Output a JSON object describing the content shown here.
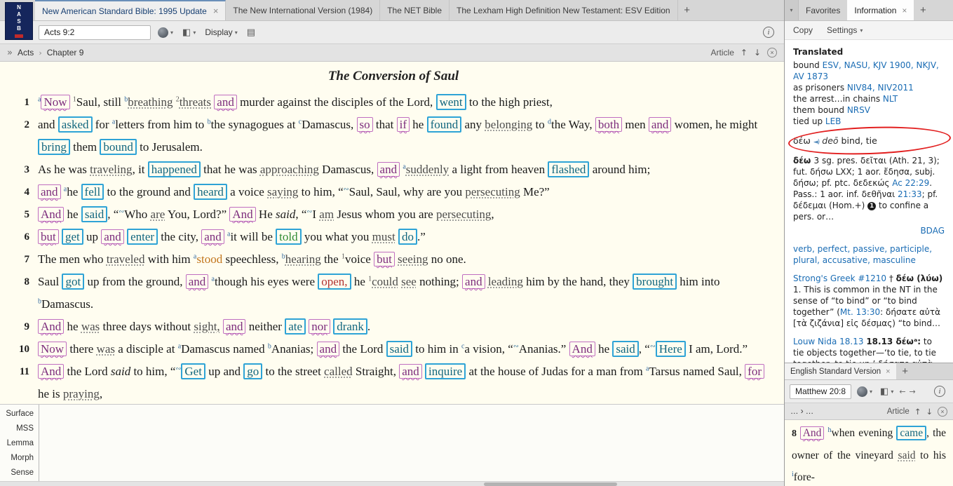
{
  "colors": {
    "accent_blue_box": "#2ea3d6",
    "accent_purple_box": "#c06ec0",
    "link_blue": "#1a6cb4",
    "annotation_red": "#e21f1f",
    "page_cream": "#fffdf0"
  },
  "icons": {
    "caret_down": "▾",
    "chevrons": "»",
    "up_arrow": "↑",
    "down_arrow": "↓",
    "back_arrow": "←",
    "forward_arrow": "→",
    "close": "×",
    "columns": "◧",
    "page": "▤",
    "info": "i",
    "crumb_sep": "›"
  },
  "main": {
    "logo": "NASB",
    "tabs": [
      {
        "label": "New American Standard Bible: 1995 Update",
        "close": "×"
      },
      {
        "label": "The New International Version (1984)"
      },
      {
        "label": "The NET Bible"
      },
      {
        "label": "The Lexham High Definition New Testament: ESV Edition"
      }
    ],
    "new_tab": "+",
    "toolbar": {
      "reference": "Acts 9:2",
      "display_label": "Display"
    },
    "locator": {
      "book": "Acts",
      "chapter": "Chapter 9",
      "article_label": "Article"
    },
    "title": "The Conversion of Saul",
    "interlinear_rows": [
      "Surface",
      "MSS",
      "Lemma",
      "Morph",
      "Sense"
    ],
    "verses": [
      {
        "num": "1",
        "tokens": [
          [
            "a",
            "sup"
          ],
          [
            "Now",
            "p"
          ],
          [
            " ",
            "t"
          ],
          [
            "1",
            "supg"
          ],
          [
            "Saul, still ",
            "t"
          ],
          [
            "b",
            "sup"
          ],
          [
            "breathing",
            "d"
          ],
          [
            " ",
            "t"
          ],
          [
            "2",
            "supg"
          ],
          [
            "threats",
            "d"
          ],
          [
            " ",
            "t"
          ],
          [
            "and",
            "p"
          ],
          [
            " murder against the disciples of the Lord, ",
            "t"
          ],
          [
            "went",
            "b"
          ],
          [
            " to the high priest,",
            "t"
          ]
        ]
      },
      {
        "num": "2",
        "tokens": [
          [
            "and ",
            "t"
          ],
          [
            "asked",
            "b"
          ],
          [
            " for ",
            "t"
          ],
          [
            "a",
            "sup"
          ],
          [
            "letters from him to ",
            "t"
          ],
          [
            "b",
            "sup"
          ],
          [
            "the synagogues at ",
            "t"
          ],
          [
            "c",
            "sup"
          ],
          [
            "Damascus, ",
            "t"
          ],
          [
            "so",
            "p"
          ],
          [
            " that ",
            "t"
          ],
          [
            "if",
            "p"
          ],
          [
            " he ",
            "t"
          ],
          [
            "found",
            "b"
          ],
          [
            " any ",
            "t"
          ],
          [
            "belonging",
            "d"
          ],
          [
            " to ",
            "t"
          ],
          [
            "d",
            "sup"
          ],
          [
            "the Way, ",
            "t"
          ],
          [
            "both",
            "p"
          ],
          [
            " men ",
            "t"
          ],
          [
            "and",
            "p"
          ],
          [
            " women, he might ",
            "t"
          ],
          [
            "bring",
            "b"
          ],
          [
            " them ",
            "t"
          ],
          [
            "bound",
            "b"
          ],
          [
            " to Jerusalem.",
            "t"
          ]
        ]
      },
      {
        "num": "3",
        "tokens": [
          [
            "As he was ",
            "t"
          ],
          [
            "traveling",
            "d"
          ],
          [
            ", it ",
            "t"
          ],
          [
            "happened",
            "b"
          ],
          [
            " that he was ",
            "t"
          ],
          [
            "approaching",
            "d"
          ],
          [
            " Damascus, ",
            "t"
          ],
          [
            "and",
            "p"
          ],
          [
            " ",
            "t"
          ],
          [
            "a",
            "sup"
          ],
          [
            "suddenly",
            "d"
          ],
          [
            " a light from heaven ",
            "t"
          ],
          [
            "flashed",
            "b"
          ],
          [
            " around him;",
            "t"
          ]
        ]
      },
      {
        "num": "4",
        "tokens": [
          [
            "and",
            "p"
          ],
          [
            " ",
            "t"
          ],
          [
            "a",
            "sup"
          ],
          [
            "he ",
            "t"
          ],
          [
            "fell",
            "b"
          ],
          [
            " to the ground and ",
            "t"
          ],
          [
            "heard",
            "b"
          ],
          [
            " a voice ",
            "t"
          ],
          [
            "saying",
            "d"
          ],
          [
            " to him, “",
            "t"
          ],
          [
            "∾",
            "m"
          ],
          [
            "Saul, Saul, why are you ",
            "t"
          ],
          [
            "persecuting",
            "d"
          ],
          [
            " Me?”",
            "t"
          ]
        ]
      },
      {
        "num": "5",
        "tokens": [
          [
            "And",
            "p"
          ],
          [
            " he ",
            "t"
          ],
          [
            "said",
            "b"
          ],
          [
            ", “",
            "t"
          ],
          [
            "∾",
            "m"
          ],
          [
            "Who ",
            "t"
          ],
          [
            "are",
            "d"
          ],
          [
            " You, Lord?” ",
            "t"
          ],
          [
            "And",
            "p"
          ],
          [
            " He ",
            "t"
          ],
          [
            "said",
            "i"
          ],
          [
            ", “",
            "t"
          ],
          [
            "∾",
            "m"
          ],
          [
            "I ",
            "t"
          ],
          [
            "am",
            "d"
          ],
          [
            " Jesus whom you are ",
            "t"
          ],
          [
            "persecuting",
            "d"
          ],
          [
            ",",
            "t"
          ]
        ]
      },
      {
        "num": "6",
        "tokens": [
          [
            "but",
            "p"
          ],
          [
            " ",
            "t"
          ],
          [
            "get",
            "b"
          ],
          [
            " up ",
            "t"
          ],
          [
            "and",
            "p"
          ],
          [
            " ",
            "t"
          ],
          [
            "enter",
            "b"
          ],
          [
            " the city, ",
            "t"
          ],
          [
            "and",
            "p"
          ],
          [
            " ",
            "t"
          ],
          [
            "a",
            "sup"
          ],
          [
            "it will be ",
            "t"
          ],
          [
            "told",
            "bg"
          ],
          [
            " you what you ",
            "t"
          ],
          [
            "must",
            "d"
          ],
          [
            " ",
            "t"
          ],
          [
            "do",
            "b"
          ],
          [
            ".”",
            "t"
          ]
        ]
      },
      {
        "num": "7",
        "tokens": [
          [
            "The men who ",
            "t"
          ],
          [
            "traveled",
            "d"
          ],
          [
            " with him ",
            "t"
          ],
          [
            "a",
            "sup"
          ],
          [
            "stood",
            "o"
          ],
          [
            " speechless, ",
            "t"
          ],
          [
            "b",
            "sup"
          ],
          [
            "hearing",
            "d"
          ],
          [
            " the ",
            "t"
          ],
          [
            "1",
            "supg"
          ],
          [
            "voice ",
            "t"
          ],
          [
            "but",
            "p"
          ],
          [
            " ",
            "t"
          ],
          [
            "seeing",
            "d"
          ],
          [
            " no one.",
            "t"
          ]
        ]
      },
      {
        "num": "8",
        "tokens": [
          [
            "Saul ",
            "t"
          ],
          [
            "got",
            "b"
          ],
          [
            " up from the ground, ",
            "t"
          ],
          [
            "and",
            "p"
          ],
          [
            " ",
            "t"
          ],
          [
            "a",
            "sup"
          ],
          [
            "though his eyes were ",
            "t"
          ],
          [
            "open,",
            "br"
          ],
          [
            " he ",
            "t"
          ],
          [
            "1",
            "supg"
          ],
          [
            "could",
            "d"
          ],
          [
            " ",
            "t"
          ],
          [
            "see",
            "d"
          ],
          [
            " nothing; ",
            "t"
          ],
          [
            "and",
            "p"
          ],
          [
            " ",
            "t"
          ],
          [
            "leading",
            "d"
          ],
          [
            " him by the hand, they ",
            "t"
          ],
          [
            "brought",
            "b"
          ],
          [
            " him into ",
            "t"
          ],
          [
            "b",
            "sup"
          ],
          [
            "Damascus.",
            "t"
          ]
        ]
      },
      {
        "num": "9",
        "tokens": [
          [
            "And",
            "p"
          ],
          [
            " he ",
            "t"
          ],
          [
            "was",
            "d"
          ],
          [
            " three days without ",
            "t"
          ],
          [
            "sight,",
            "d"
          ],
          [
            " ",
            "t"
          ],
          [
            "and",
            "p"
          ],
          [
            " neither ",
            "t"
          ],
          [
            "ate",
            "b"
          ],
          [
            " ",
            "t"
          ],
          [
            "nor",
            "p"
          ],
          [
            " ",
            "t"
          ],
          [
            "drank",
            "b"
          ],
          [
            ".",
            "t"
          ]
        ]
      },
      {
        "num": "10",
        "tokens": [
          [
            "Now",
            "p"
          ],
          [
            " there ",
            "t"
          ],
          [
            "was",
            "d"
          ],
          [
            " a disciple at ",
            "t"
          ],
          [
            "a",
            "sup"
          ],
          [
            "Damascus named ",
            "t"
          ],
          [
            "b",
            "sup"
          ],
          [
            "Ananias; ",
            "t"
          ],
          [
            "and",
            "p"
          ],
          [
            " the Lord ",
            "t"
          ],
          [
            "said",
            "b"
          ],
          [
            " to him in ",
            "t"
          ],
          [
            "c",
            "sup"
          ],
          [
            "a vision, “",
            "t"
          ],
          [
            "∾",
            "m"
          ],
          [
            "Ananias.” ",
            "t"
          ],
          [
            "And",
            "p"
          ],
          [
            " he ",
            "t"
          ],
          [
            "said",
            "b"
          ],
          [
            ", “",
            "t"
          ],
          [
            "∾",
            "m"
          ],
          [
            "Here",
            "b"
          ],
          [
            " I am, Lord.”",
            "t"
          ]
        ]
      },
      {
        "num": "11",
        "tokens": [
          [
            "And",
            "p"
          ],
          [
            " the Lord ",
            "t"
          ],
          [
            "said",
            "i"
          ],
          [
            " to him, “",
            "t"
          ],
          [
            "∾",
            "m"
          ],
          [
            "Get",
            "b"
          ],
          [
            " up and ",
            "t"
          ],
          [
            "go",
            "b"
          ],
          [
            " to the street ",
            "t"
          ],
          [
            "called",
            "d"
          ],
          [
            " Straight, ",
            "t"
          ],
          [
            "and",
            "p"
          ],
          [
            " ",
            "t"
          ],
          [
            "inquire",
            "b"
          ],
          [
            " at the house of Judas for a man from ",
            "t"
          ],
          [
            "a",
            "sup"
          ],
          [
            "Tarsus named Saul, ",
            "t"
          ],
          [
            "for",
            "p"
          ],
          [
            " he is ",
            "t"
          ],
          [
            "praying",
            "d"
          ],
          [
            ",",
            "t"
          ]
        ]
      }
    ]
  },
  "info_panel": {
    "tabs": [
      {
        "label": "Favorites"
      },
      {
        "label": "Information",
        "close": "×"
      }
    ],
    "new_tab": "+",
    "menu": {
      "copy": "Copy",
      "settings": "Settings"
    },
    "heading": "Translated",
    "translations": [
      {
        "text": "bound ",
        "versions": "ESV, NASU, KJV 1900, NKJV, AV 1873"
      },
      {
        "text": "as prisoners ",
        "versions": "NIV84, NIV2011"
      },
      {
        "text": "the arrest…in chains ",
        "versions": "NLT"
      },
      {
        "text": "them bound ",
        "versions": "NRSV"
      },
      {
        "text": "tied up ",
        "versions": "LEB"
      }
    ],
    "pronunciation": {
      "tokens": [
        [
          "δέω ",
          "t"
        ],
        [
          "◄)",
          "spk"
        ],
        [
          "  ",
          "t"
        ],
        [
          "deō",
          "translit"
        ],
        [
          "  bind, tie",
          "t"
        ]
      ]
    },
    "bdag": {
      "tokens": [
        [
          "δέω ",
          "bld"
        ],
        [
          "3 sg. pres. δεῖται (Ath. 21, 3); fut. δήσω LXX; 1 aor. ἔδησα, subj. δήσω; pf. ptc. δεδεκώς ",
          "t"
        ],
        [
          "Ac 22:29",
          "link"
        ],
        [
          ". Pass.: 1 aor. inf. δεθῆναι ",
          "t"
        ],
        [
          "21:33",
          "link"
        ],
        [
          "; pf. δέδεμαι (Hom.+) ",
          "t"
        ],
        [
          "1",
          "badge"
        ],
        [
          " to confine a pers. or…",
          "t"
        ]
      ],
      "source": "BDAG"
    },
    "morphology": "verb, perfect, passive, participle, plural, accusative, masculine",
    "strongs": {
      "tokens": [
        [
          "Strong's Greek #1210",
          "link"
        ],
        [
          " † ",
          "t"
        ],
        [
          "δέω (λύω)",
          "bld"
        ],
        [
          " 1. This is common in the NT in the sense of “to bind” or “to bind together” (",
          "t"
        ],
        [
          "Mt. 13:30",
          "link"
        ],
        [
          ": δήσατε αὐτὰ [τὰ ζιζάνια] εἰς δέσμας) “to bind…",
          "t"
        ]
      ]
    },
    "louw": {
      "tokens": [
        [
          "Louw Nida 18.13",
          "link"
        ],
        [
          " ",
          "t"
        ],
        [
          "18.13 δέωᵃ:",
          "bld"
        ],
        [
          " to tie objects together—‘to tie, to tie together, to tie up.’ δήσατε αὐτὰ εἰς δέσμας ‘tie these into bundles’ Mt",
          "t"
        ]
      ]
    }
  },
  "esv_panel": {
    "tab": {
      "label": "English Standard Version",
      "close": "×"
    },
    "new_tab": "+",
    "toolbar": {
      "reference": "Matthew 20:8"
    },
    "locator": {
      "path": "… › …",
      "article_label": "Article"
    },
    "verse": {
      "num": "8",
      "tokens": [
        [
          "And",
          "p"
        ],
        [
          " ",
          "t"
        ],
        [
          "h",
          "sup"
        ],
        [
          "when evening ",
          "t"
        ],
        [
          "came",
          "b"
        ],
        [
          ", the owner of the vineyard ",
          "t"
        ],
        [
          "said",
          "d"
        ],
        [
          " to his ",
          "t"
        ],
        [
          "i",
          "sup"
        ],
        [
          "fore-",
          "t"
        ]
      ]
    }
  }
}
